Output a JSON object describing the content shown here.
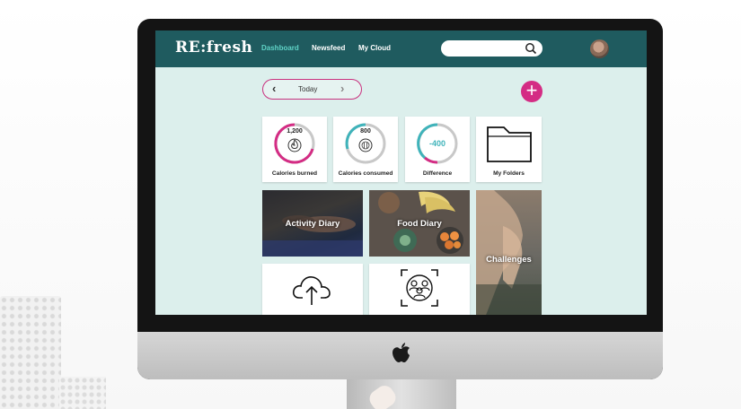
{
  "app": {
    "logo": "RE:fresh"
  },
  "nav": {
    "dashboard": "Dashboard",
    "newsfeed": "Newsfeed",
    "my_cloud": "My Cloud"
  },
  "search": {
    "placeholder": ""
  },
  "date_nav": {
    "label": "Today",
    "prev": "‹",
    "next": "›"
  },
  "add_button": "+",
  "stats": {
    "burned": {
      "value": "1,200",
      "label": "Calories burned"
    },
    "consumed": {
      "value": "800",
      "label": "Calories consumed"
    },
    "difference": {
      "value": "-400",
      "label": "Difference"
    }
  },
  "folders": {
    "label": "My Folders"
  },
  "tiles": {
    "activity": "Activity Diary",
    "food": "Food Diary",
    "challenges": "Challenges"
  },
  "colors": {
    "topbar": "#1f5b5f",
    "background": "#dcefec",
    "accent_pink": "#d42c84",
    "accent_teal": "#3fb3ba"
  },
  "icons": [
    "search-icon",
    "flame-icon",
    "plate-icon",
    "folder-icon",
    "cloud-upload-icon",
    "group-target-icon",
    "apple-icon"
  ]
}
